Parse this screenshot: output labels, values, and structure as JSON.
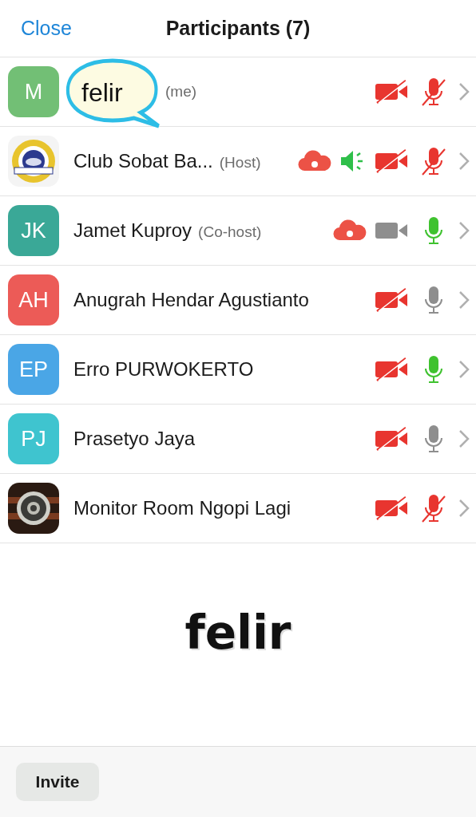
{
  "header": {
    "close": "Close",
    "title": "Participants (7)"
  },
  "participants": [
    {
      "avatar": {
        "kind": "initials",
        "text": "M",
        "color": "#72bf75"
      },
      "role": "(me)",
      "recording": false,
      "speaker_on": false,
      "video_on": false,
      "muted": true
    },
    {
      "name": "Club Sobat Ba...",
      "role": "(Host)",
      "recording": true,
      "speaker_on": true,
      "video_on": false,
      "muted": true
    },
    {
      "avatar": {
        "kind": "initials",
        "text": "JK",
        "color": "#3aa897"
      },
      "name": "Jamet Kuproy",
      "role": "(Co-host)",
      "recording": true,
      "speaker_on": false,
      "video_on": true,
      "muted": false,
      "mic_active": true
    },
    {
      "avatar": {
        "kind": "initials",
        "text": "AH",
        "color": "#ec5b57"
      },
      "name": "Anugrah Hendar Agustianto",
      "recording": false,
      "speaker_on": false,
      "video_on": false,
      "muted": false,
      "mic_active": false
    },
    {
      "avatar": {
        "kind": "initials",
        "text": "EP",
        "color": "#4aa6e6"
      },
      "name": "Erro PURWOKERTO",
      "recording": false,
      "speaker_on": false,
      "video_on": false,
      "muted": false,
      "mic_active": true
    },
    {
      "avatar": {
        "kind": "initials",
        "text": "PJ",
        "color": "#3fc4cf"
      },
      "name": "Prasetyo Jaya",
      "recording": false,
      "speaker_on": false,
      "video_on": false,
      "muted": false,
      "mic_active": false
    },
    {
      "name": "Monitor Room Ngopi Lagi",
      "recording": false,
      "speaker_on": false,
      "video_on": false,
      "muted": true
    }
  ],
  "stickers": {
    "bubble": "felir",
    "caption": "felir"
  },
  "footer": {
    "invite": "Invite"
  }
}
